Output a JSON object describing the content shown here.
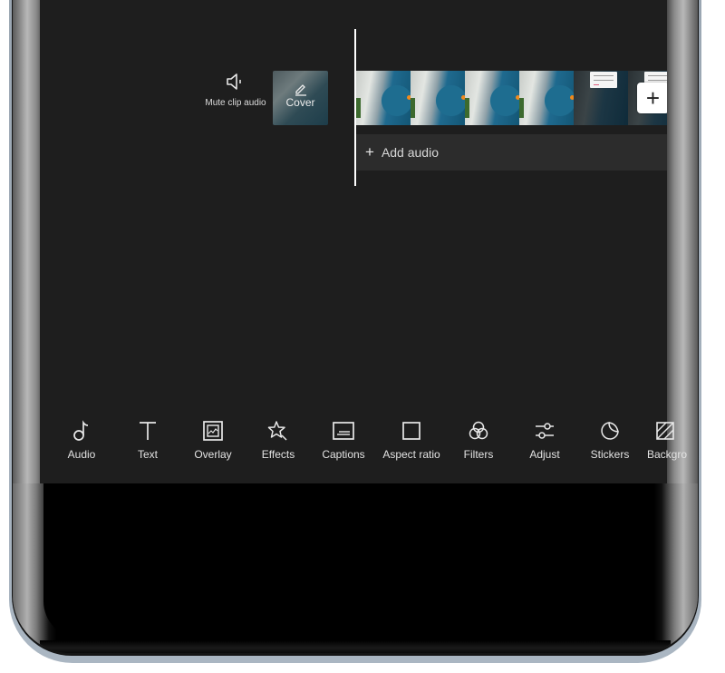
{
  "timeline": {
    "mute_clip_audio": {
      "label": "Mute clip audio",
      "icon": "speaker-icon"
    },
    "cover": {
      "label": "Cover",
      "icon": "pencil-icon"
    },
    "add_clip": {
      "label": "+",
      "icon": "plus-icon"
    },
    "add_audio": {
      "plus": "+",
      "label": "Add audio"
    },
    "frames": [
      {
        "type": "coast"
      },
      {
        "type": "coast"
      },
      {
        "type": "coast"
      },
      {
        "type": "coast"
      },
      {
        "type": "dark"
      },
      {
        "type": "dark"
      }
    ]
  },
  "toolbar": {
    "items": [
      {
        "label": "Audio",
        "icon": "music-note-icon"
      },
      {
        "label": "Text",
        "icon": "text-icon"
      },
      {
        "label": "Overlay",
        "icon": "overlay-icon"
      },
      {
        "label": "Effects",
        "icon": "star-wand-icon"
      },
      {
        "label": "Captions",
        "icon": "captions-icon"
      },
      {
        "label": "Aspect ratio",
        "icon": "square-icon"
      },
      {
        "label": "Filters",
        "icon": "filters-icon"
      },
      {
        "label": "Adjust",
        "icon": "sliders-icon"
      },
      {
        "label": "Stickers",
        "icon": "sticker-icon"
      },
      {
        "label": "Backgro",
        "icon": "background-icon"
      }
    ]
  },
  "colors": {
    "screen_bg": "#1e1e1e",
    "track_bg": "#2c2c2c",
    "playhead": "#ffffff"
  }
}
